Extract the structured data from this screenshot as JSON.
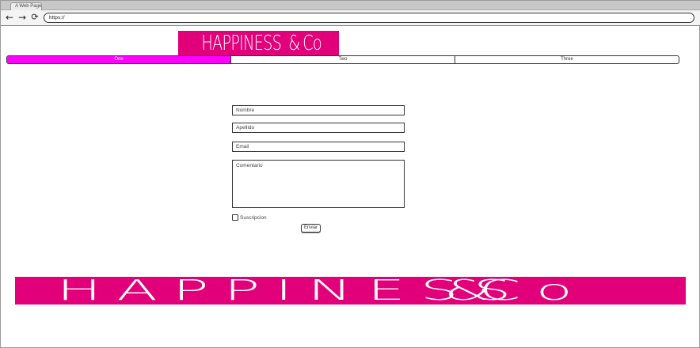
{
  "browser": {
    "tab_title": "A Web Page",
    "url": "https://",
    "back_icon": "←",
    "forward_icon": "→",
    "reload_icon": "⟳"
  },
  "header": {
    "logo_text_pre": "HAPPINESS",
    "logo_amp": "&",
    "logo_text_post": "Co",
    "logo_color": "#e2007a"
  },
  "menu": {
    "tabs": [
      {
        "label": "One",
        "active": true
      },
      {
        "label": "Two",
        "active": false
      },
      {
        "label": "Three",
        "active": false
      }
    ],
    "active_color": "#ff00ff"
  },
  "form": {
    "nombre_placeholder": "Nombre",
    "apellido_placeholder": "Apellido",
    "email_placeholder": "Email",
    "comentario_placeholder": "Comentario",
    "suscripcion_label": "Suscripcion",
    "suscripcion_checked": false,
    "submit_label": "Enviar"
  },
  "footer": {
    "logo_text_pre": "HAPPINESS",
    "logo_amp": "&",
    "logo_text_post": "Co"
  }
}
